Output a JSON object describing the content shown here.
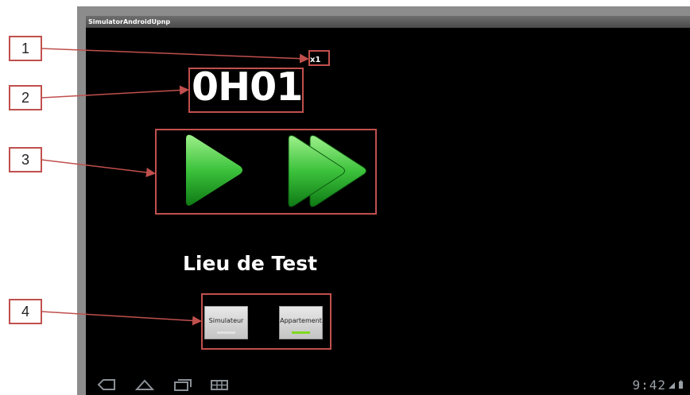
{
  "app": {
    "title": "SimulatorAndroidUpnp"
  },
  "simulation": {
    "speed_label": "x1",
    "timer": "0H01"
  },
  "controls": {
    "play_icon": "play-icon",
    "fast_forward_icon": "fast-forward-icon"
  },
  "location": {
    "title": "Lieu de Test",
    "options": [
      {
        "label": "Simulateur",
        "indicator_color": "#e0e0e0"
      },
      {
        "label": "Appartement",
        "indicator_color": "#7fd81f"
      }
    ]
  },
  "system_bar": {
    "clock": "9:42"
  },
  "callouts": [
    "1",
    "2",
    "3",
    "4"
  ],
  "colors": {
    "annotation": "#c0504d",
    "accent_green": "#33b53d"
  }
}
